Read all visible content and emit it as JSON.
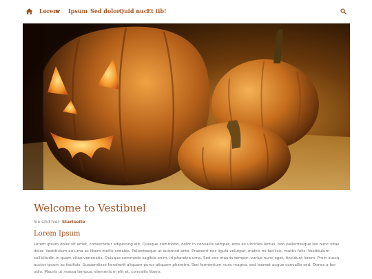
{
  "nav": {
    "home_icon": "home-icon",
    "items": [
      {
        "label": "Lorem",
        "has_dropdown": true
      },
      {
        "label": "Ipsum"
      },
      {
        "label": "Sed dolor"
      },
      {
        "label": "Quid nuc"
      },
      {
        "label": "Et tib!"
      }
    ],
    "dropdown_icon": "chevron-down-icon",
    "search_icon": "search-icon"
  },
  "hero": {
    "icon": "halloween-pumpkins-photo"
  },
  "page": {
    "title": "Welcome to Vestibuel",
    "breadcrumb_prefix": "Sie sind hier:",
    "breadcrumb_link": "Startseite",
    "section_heading": "Lorem Ipsum",
    "body_lines": [
      "Lorem ipsum dolor sit amet, consectetur adipiscing elit. Quisque commodo, dolor in convallis semper, eros ex ultricies lectus, non pellentesque leo nunc vitae",
      "dolor. Vestibulum eu urna ac libero mollis sodales. Pellentesque ut euismod ante. Praesent nec ligula volutpat, mattis mi facilisis, mattis felis. Vestibulum",
      "sollicitudin in quam vitae venenatis. Quisque commodo sagittis enim, id pharetra urna. Sed nec mauris tempor, varius nunc eget, tincidunt lorem. Proin suscipit",
      "auctor ipsum ac facilisis. Suspendisse hendrerit aliquam purus aliquam pharetra. Sed fermentum nunc magna, sed laoreet augue convallis sed. Donec a leo",
      "odio. Mauris ut massa tempus, elementum elit et, convallis libero."
    ]
  },
  "colors": {
    "accent": "#a4521f",
    "text_muted": "#6f6f6f",
    "background": "#ffffff"
  }
}
